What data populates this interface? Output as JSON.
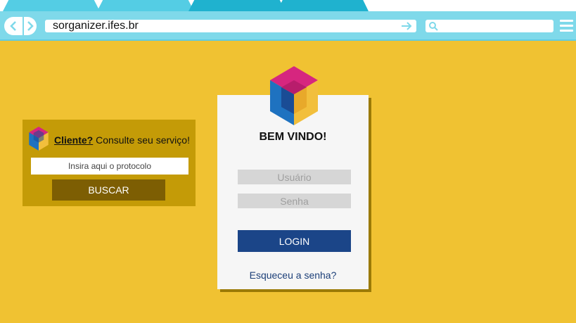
{
  "browser": {
    "url": "sorganizer.ifes.br",
    "nav_icons": [
      "back-arrow-icon",
      "forward-arrow-icon"
    ],
    "go_icon": "arrow-right-icon",
    "search_icon": "magnifier-icon",
    "menu_icon": "hamburger-menu-icon"
  },
  "client_panel": {
    "link_label": "Cliente?",
    "heading_rest": " Consulte seu serviço!",
    "protocol_placeholder": "Insira aqui o protocolo",
    "search_button": "BUSCAR"
  },
  "login": {
    "welcome": "BEM VINDO!",
    "user_placeholder": "Usuário",
    "password_placeholder": "Senha",
    "login_button": "LOGIN",
    "forgot_link": "Esqueceu a senha?"
  },
  "colors": {
    "background": "#f0c232",
    "toolbar": "#7fd9ea",
    "client_panel": "#c49b07",
    "search_button": "#7d5e03",
    "login_button": "#1b4588",
    "logo_top": "#d6267f",
    "logo_left": "#1e72c0",
    "logo_right": "#f2bf3c"
  }
}
